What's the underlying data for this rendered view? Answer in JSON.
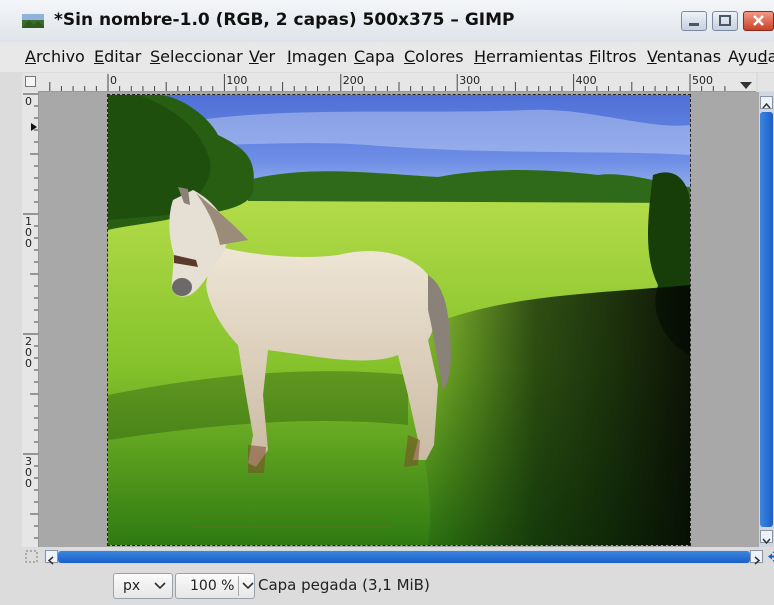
{
  "window": {
    "title": "*Sin nombre-1.0 (RGB, 2 capas) 500x375 – GIMP"
  },
  "menubar": [
    {
      "id": "archivo",
      "pre": "",
      "u": "A",
      "post": "rchivo"
    },
    {
      "id": "editar",
      "pre": "",
      "u": "E",
      "post": "ditar"
    },
    {
      "id": "seleccionar",
      "pre": "",
      "u": "S",
      "post": "eleccionar"
    },
    {
      "id": "ver",
      "pre": "",
      "u": "V",
      "post": "er"
    },
    {
      "id": "imagen",
      "pre": "",
      "u": "I",
      "post": "magen"
    },
    {
      "id": "capa",
      "pre": "",
      "u": "C",
      "post": "apa"
    },
    {
      "id": "colores",
      "pre": "",
      "u": "C",
      "post": "olores"
    },
    {
      "id": "herramientas",
      "pre": "",
      "u": "H",
      "post": "erramientas"
    },
    {
      "id": "filtros",
      "pre": "",
      "u": "F",
      "post": "iltros"
    },
    {
      "id": "ventanas",
      "pre": "",
      "u": "V",
      "post": "entanas"
    },
    {
      "id": "ayuda",
      "pre": "Ayu",
      "u": "d",
      "post": "a"
    }
  ],
  "rulers": {
    "horizontal_labels": [
      "0",
      "100",
      "200",
      "300",
      "400",
      "500"
    ],
    "vertical_labels": [
      "0",
      "100",
      "200",
      "300"
    ]
  },
  "statusbar": {
    "unit": "px",
    "zoom": "100 %",
    "status": "Capa pegada (3,1 MiB)"
  },
  "colors": {
    "accent": "#1b5fc8",
    "close_button": "#c9422b"
  },
  "icons": [
    "gimp-icon",
    "minimize-icon",
    "maximize-icon",
    "close-icon",
    "quick-mask-icon",
    "navigate-icon",
    "zoom-follow-icon",
    "chevron-down-icon"
  ]
}
